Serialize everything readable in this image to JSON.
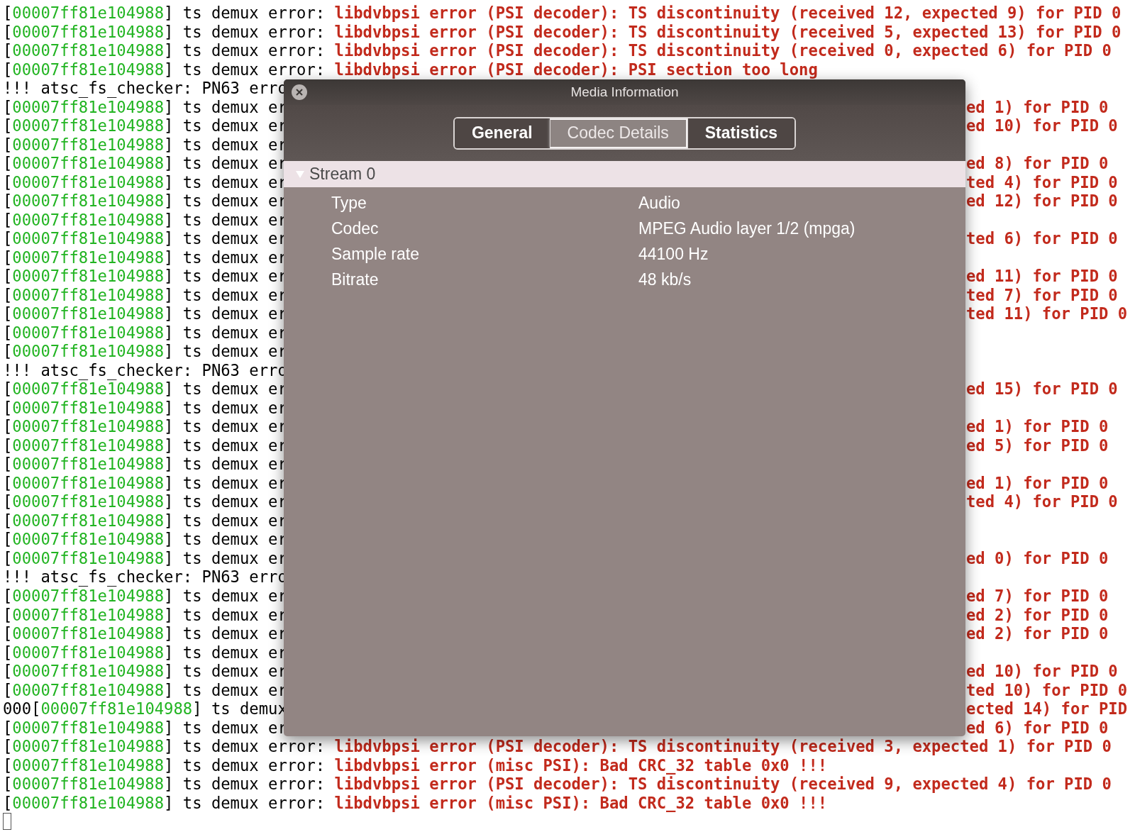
{
  "terminal": {
    "lines": [
      {
        "left": [
          {
            "text": "[",
            "kind": "plain"
          },
          {
            "text": "00007ff81e104988",
            "kind": "address"
          },
          {
            "text": "] ts demux error: ",
            "kind": "plain"
          },
          {
            "text": "libdvbpsi error (PSI decoder): TS discontinuity (received 12, expected 9) for PID 0",
            "kind": "error"
          }
        ]
      },
      {
        "left": [
          {
            "text": "[",
            "kind": "plain"
          },
          {
            "text": "00007ff81e104988",
            "kind": "address"
          },
          {
            "text": "] ts demux error: ",
            "kind": "plain"
          },
          {
            "text": "libdvbpsi error (PSI decoder): TS discontinuity (received 5, expected 13) for PID 0",
            "kind": "error"
          }
        ]
      },
      {
        "left": [
          {
            "text": "[",
            "kind": "plain"
          },
          {
            "text": "00007ff81e104988",
            "kind": "address"
          },
          {
            "text": "] ts demux error: ",
            "kind": "plain"
          },
          {
            "text": "libdvbpsi error (PSI decoder): TS discontinuity (received 0, expected 6) for PID 0",
            "kind": "error"
          }
        ]
      },
      {
        "left": [
          {
            "text": "[",
            "kind": "plain"
          },
          {
            "text": "00007ff81e104988",
            "kind": "address"
          },
          {
            "text": "] ts demux error: ",
            "kind": "plain"
          },
          {
            "text": "libdvbpsi error (PSI decoder): PSI section too long",
            "kind": "error"
          }
        ]
      },
      {
        "left": [
          {
            "text": "!!! atsc_fs_checker: PN63 erro",
            "kind": "plain"
          }
        ]
      },
      {
        "left": [
          {
            "text": "[",
            "kind": "plain"
          },
          {
            "text": "00007ff81e104988",
            "kind": "address"
          },
          {
            "text": "] ts demux er",
            "kind": "plain"
          }
        ],
        "right": [
          {
            "text": "ed 1) for PID 0",
            "kind": "error"
          }
        ]
      },
      {
        "left": [
          {
            "text": "[",
            "kind": "plain"
          },
          {
            "text": "00007ff81e104988",
            "kind": "address"
          },
          {
            "text": "] ts demux er",
            "kind": "plain"
          }
        ],
        "right": [
          {
            "text": "ed 10) for PID 0",
            "kind": "error"
          }
        ]
      },
      {
        "left": [
          {
            "text": "[",
            "kind": "plain"
          },
          {
            "text": "00007ff81e104988",
            "kind": "address"
          },
          {
            "text": "] ts demux er",
            "kind": "plain"
          }
        ]
      },
      {
        "left": [
          {
            "text": "[",
            "kind": "plain"
          },
          {
            "text": "00007ff81e104988",
            "kind": "address"
          },
          {
            "text": "] ts demux er",
            "kind": "plain"
          }
        ],
        "right": [
          {
            "text": "ed 8) for PID 0",
            "kind": "error"
          }
        ]
      },
      {
        "left": [
          {
            "text": "[",
            "kind": "plain"
          },
          {
            "text": "00007ff81e104988",
            "kind": "address"
          },
          {
            "text": "] ts demux er",
            "kind": "plain"
          }
        ],
        "right": [
          {
            "text": "ted 4) for PID 0",
            "kind": "error"
          }
        ]
      },
      {
        "left": [
          {
            "text": "[",
            "kind": "plain"
          },
          {
            "text": "00007ff81e104988",
            "kind": "address"
          },
          {
            "text": "] ts demux er",
            "kind": "plain"
          }
        ],
        "right": [
          {
            "text": "ed 12) for PID 0",
            "kind": "error"
          }
        ]
      },
      {
        "left": [
          {
            "text": "[",
            "kind": "plain"
          },
          {
            "text": "00007ff81e104988",
            "kind": "address"
          },
          {
            "text": "] ts demux er",
            "kind": "plain"
          }
        ]
      },
      {
        "left": [
          {
            "text": "[",
            "kind": "plain"
          },
          {
            "text": "00007ff81e104988",
            "kind": "address"
          },
          {
            "text": "] ts demux er",
            "kind": "plain"
          }
        ],
        "right": [
          {
            "text": "ted 6) for PID 0",
            "kind": "error"
          }
        ]
      },
      {
        "left": [
          {
            "text": "[",
            "kind": "plain"
          },
          {
            "text": "00007ff81e104988",
            "kind": "address"
          },
          {
            "text": "] ts demux er",
            "kind": "plain"
          }
        ]
      },
      {
        "left": [
          {
            "text": "[",
            "kind": "plain"
          },
          {
            "text": "00007ff81e104988",
            "kind": "address"
          },
          {
            "text": "] ts demux er",
            "kind": "plain"
          }
        ],
        "right": [
          {
            "text": "ed 11) for PID 0",
            "kind": "error"
          }
        ]
      },
      {
        "left": [
          {
            "text": "[",
            "kind": "plain"
          },
          {
            "text": "00007ff81e104988",
            "kind": "address"
          },
          {
            "text": "] ts demux er",
            "kind": "plain"
          }
        ],
        "right": [
          {
            "text": "ted 7) for PID 0",
            "kind": "error"
          }
        ]
      },
      {
        "left": [
          {
            "text": "[",
            "kind": "plain"
          },
          {
            "text": "00007ff81e104988",
            "kind": "address"
          },
          {
            "text": "] ts demux er",
            "kind": "plain"
          }
        ],
        "right": [
          {
            "text": "ted 11) for PID 0",
            "kind": "error"
          }
        ]
      },
      {
        "left": [
          {
            "text": "[",
            "kind": "plain"
          },
          {
            "text": "00007ff81e104988",
            "kind": "address"
          },
          {
            "text": "] ts demux er",
            "kind": "plain"
          }
        ]
      },
      {
        "left": [
          {
            "text": "[",
            "kind": "plain"
          },
          {
            "text": "00007ff81e104988",
            "kind": "address"
          },
          {
            "text": "] ts demux er",
            "kind": "plain"
          }
        ]
      },
      {
        "left": [
          {
            "text": "!!! atsc_fs_checker: PN63 erro",
            "kind": "plain"
          }
        ]
      },
      {
        "left": [
          {
            "text": "[",
            "kind": "plain"
          },
          {
            "text": "00007ff81e104988",
            "kind": "address"
          },
          {
            "text": "] ts demux er",
            "kind": "plain"
          }
        ],
        "right": [
          {
            "text": "ed 15) for PID 0",
            "kind": "error"
          }
        ]
      },
      {
        "left": [
          {
            "text": "[",
            "kind": "plain"
          },
          {
            "text": "00007ff81e104988",
            "kind": "address"
          },
          {
            "text": "] ts demux er",
            "kind": "plain"
          }
        ]
      },
      {
        "left": [
          {
            "text": "[",
            "kind": "plain"
          },
          {
            "text": "00007ff81e104988",
            "kind": "address"
          },
          {
            "text": "] ts demux er",
            "kind": "plain"
          }
        ],
        "right": [
          {
            "text": "ed 1) for PID 0",
            "kind": "error"
          }
        ]
      },
      {
        "left": [
          {
            "text": "[",
            "kind": "plain"
          },
          {
            "text": "00007ff81e104988",
            "kind": "address"
          },
          {
            "text": "] ts demux er",
            "kind": "plain"
          }
        ],
        "right": [
          {
            "text": "ed 5) for PID 0",
            "kind": "error"
          }
        ]
      },
      {
        "left": [
          {
            "text": "[",
            "kind": "plain"
          },
          {
            "text": "00007ff81e104988",
            "kind": "address"
          },
          {
            "text": "] ts demux er",
            "kind": "plain"
          }
        ]
      },
      {
        "left": [
          {
            "text": "[",
            "kind": "plain"
          },
          {
            "text": "00007ff81e104988",
            "kind": "address"
          },
          {
            "text": "] ts demux er",
            "kind": "plain"
          }
        ],
        "right": [
          {
            "text": "ed 1) for PID 0",
            "kind": "error"
          }
        ]
      },
      {
        "left": [
          {
            "text": "[",
            "kind": "plain"
          },
          {
            "text": "00007ff81e104988",
            "kind": "address"
          },
          {
            "text": "] ts demux er",
            "kind": "plain"
          }
        ],
        "right": [
          {
            "text": "ted 4) for PID 0",
            "kind": "error"
          }
        ]
      },
      {
        "left": [
          {
            "text": "[",
            "kind": "plain"
          },
          {
            "text": "00007ff81e104988",
            "kind": "address"
          },
          {
            "text": "] ts demux er",
            "kind": "plain"
          }
        ]
      },
      {
        "left": [
          {
            "text": "[",
            "kind": "plain"
          },
          {
            "text": "00007ff81e104988",
            "kind": "address"
          },
          {
            "text": "] ts demux er",
            "kind": "plain"
          }
        ]
      },
      {
        "left": [
          {
            "text": "[",
            "kind": "plain"
          },
          {
            "text": "00007ff81e104988",
            "kind": "address"
          },
          {
            "text": "] ts demux er",
            "kind": "plain"
          }
        ],
        "right": [
          {
            "text": "ed 0) for PID 0",
            "kind": "error"
          }
        ]
      },
      {
        "left": [
          {
            "text": "!!! atsc_fs_checker: PN63 erro",
            "kind": "plain"
          }
        ]
      },
      {
        "left": [
          {
            "text": "[",
            "kind": "plain"
          },
          {
            "text": "00007ff81e104988",
            "kind": "address"
          },
          {
            "text": "] ts demux er",
            "kind": "plain"
          }
        ],
        "right": [
          {
            "text": "ed 7) for PID 0",
            "kind": "error"
          }
        ]
      },
      {
        "left": [
          {
            "text": "[",
            "kind": "plain"
          },
          {
            "text": "00007ff81e104988",
            "kind": "address"
          },
          {
            "text": "] ts demux er",
            "kind": "plain"
          }
        ],
        "right": [
          {
            "text": "ed 2) for PID 0",
            "kind": "error"
          }
        ]
      },
      {
        "left": [
          {
            "text": "[",
            "kind": "plain"
          },
          {
            "text": "00007ff81e104988",
            "kind": "address"
          },
          {
            "text": "] ts demux er",
            "kind": "plain"
          }
        ],
        "right": [
          {
            "text": "ed 2) for PID 0",
            "kind": "error"
          }
        ]
      },
      {
        "left": [
          {
            "text": "[",
            "kind": "plain"
          },
          {
            "text": "00007ff81e104988",
            "kind": "address"
          },
          {
            "text": "] ts demux er",
            "kind": "plain"
          }
        ]
      },
      {
        "left": [
          {
            "text": "[",
            "kind": "plain"
          },
          {
            "text": "00007ff81e104988",
            "kind": "address"
          },
          {
            "text": "] ts demux er",
            "kind": "plain"
          }
        ],
        "right": [
          {
            "text": "ed 10) for PID 0",
            "kind": "error"
          }
        ]
      },
      {
        "left": [
          {
            "text": "[",
            "kind": "plain"
          },
          {
            "text": "00007ff81e104988",
            "kind": "address"
          },
          {
            "text": "] ts demux er",
            "kind": "plain"
          }
        ],
        "right": [
          {
            "text": "ted 10) for PID 0",
            "kind": "error"
          }
        ]
      },
      {
        "left": [
          {
            "text": "000[",
            "kind": "plain"
          },
          {
            "text": "00007ff81e104988",
            "kind": "address"
          },
          {
            "text": "] ts demux",
            "kind": "plain"
          }
        ],
        "right": [
          {
            "text": "ected 14) for PID",
            "kind": "error"
          }
        ]
      },
      {
        "left": [
          {
            "text": "[",
            "kind": "plain"
          },
          {
            "text": "00007ff81e104988",
            "kind": "address"
          },
          {
            "text": "] ts demux er",
            "kind": "plain"
          }
        ],
        "right": [
          {
            "text": "ed 6) for PID 0",
            "kind": "error"
          }
        ]
      },
      {
        "left": [
          {
            "text": "[",
            "kind": "plain"
          },
          {
            "text": "00007ff81e104988",
            "kind": "address"
          },
          {
            "text": "] ts demux error: ",
            "kind": "plain"
          },
          {
            "text": "libdvbpsi error (PSI decoder): TS discontinuity (received 3, expected 1) for PID 0",
            "kind": "error"
          }
        ]
      },
      {
        "left": [
          {
            "text": "[",
            "kind": "plain"
          },
          {
            "text": "00007ff81e104988",
            "kind": "address"
          },
          {
            "text": "] ts demux error: ",
            "kind": "plain"
          },
          {
            "text": "libdvbpsi error (misc PSI): Bad CRC_32 table 0x0 !!!",
            "kind": "error"
          }
        ]
      },
      {
        "left": [
          {
            "text": "[",
            "kind": "plain"
          },
          {
            "text": "00007ff81e104988",
            "kind": "address"
          },
          {
            "text": "] ts demux error: ",
            "kind": "plain"
          },
          {
            "text": "libdvbpsi error (PSI decoder): TS discontinuity (received 9, expected 4) for PID 0",
            "kind": "error"
          }
        ]
      },
      {
        "left": [
          {
            "text": "[",
            "kind": "plain"
          },
          {
            "text": "00007ff81e104988",
            "kind": "address"
          },
          {
            "text": "] ts demux error: ",
            "kind": "plain"
          },
          {
            "text": "libdvbpsi error (misc PSI): Bad CRC_32 table 0x0 !!!",
            "kind": "error"
          }
        ]
      }
    ]
  },
  "window": {
    "title": "Media Information",
    "tabs": [
      {
        "label": "General",
        "selected": false
      },
      {
        "label": "Codec Details",
        "selected": true
      },
      {
        "label": "Statistics",
        "selected": false
      }
    ],
    "stream": {
      "label": "Stream 0",
      "expanded": true,
      "rows": [
        {
          "label": "Type",
          "value": "Audio"
        },
        {
          "label": "Codec",
          "value": "MPEG Audio layer 1/2 (mpga)"
        },
        {
          "label": "Sample rate",
          "value": "44100 Hz"
        },
        {
          "label": "Bitrate",
          "value": "48 kb/s"
        }
      ]
    }
  }
}
